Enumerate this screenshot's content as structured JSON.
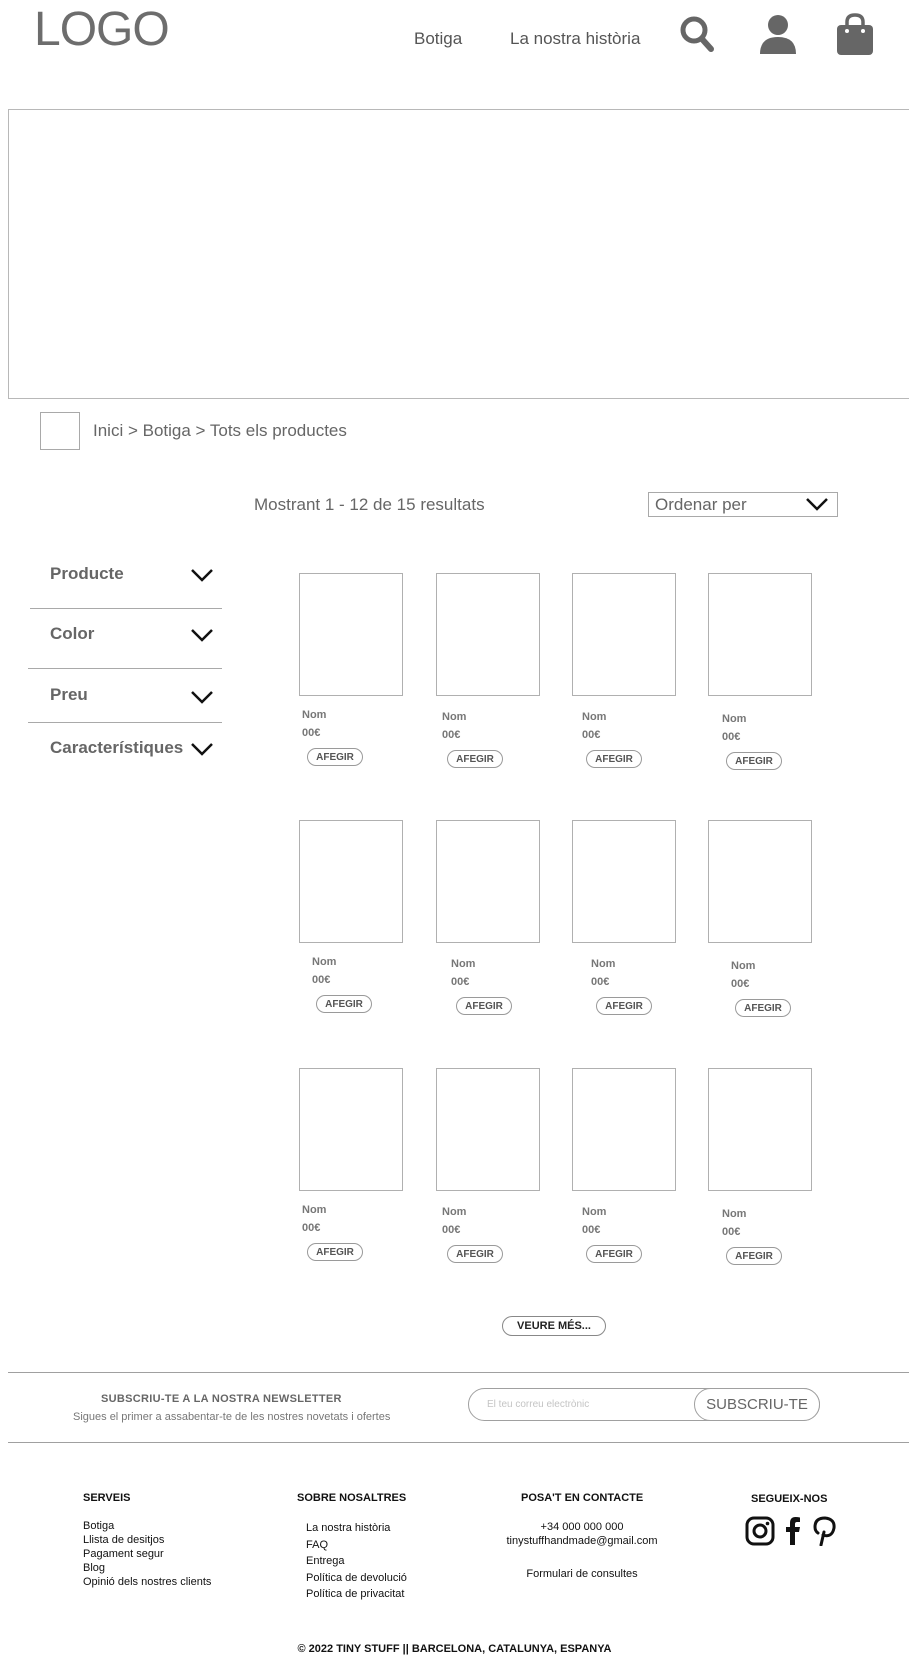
{
  "header": {
    "logo": "LOGO",
    "nav": [
      "Botiga",
      "La nostra història"
    ],
    "icons": [
      "search-icon",
      "user-icon",
      "shopping-bag-icon"
    ]
  },
  "breadcrumb": "Inici > Botiga > Tots els productes",
  "results_text": "Mostrant 1 - 12 de 15 resultats",
  "sort": {
    "label": "Ordenar per"
  },
  "filters": [
    "Producte",
    "Color",
    "Preu",
    "Característiques"
  ],
  "products": [
    {
      "name": "Nom",
      "price": "00€",
      "button": "AFEGIR"
    },
    {
      "name": "Nom",
      "price": "00€",
      "button": "AFEGIR"
    },
    {
      "name": "Nom",
      "price": "00€",
      "button": "AFEGIR"
    },
    {
      "name": "Nom",
      "price": "00€",
      "button": "AFEGIR"
    },
    {
      "name": "Nom",
      "price": "00€",
      "button": "AFEGIR"
    },
    {
      "name": "Nom",
      "price": "00€",
      "button": "AFEGIR"
    },
    {
      "name": "Nom",
      "price": "00€",
      "button": "AFEGIR"
    },
    {
      "name": "Nom",
      "price": "00€",
      "button": "AFEGIR"
    },
    {
      "name": "Nom",
      "price": "00€",
      "button": "AFEGIR"
    },
    {
      "name": "Nom",
      "price": "00€",
      "button": "AFEGIR"
    },
    {
      "name": "Nom",
      "price": "00€",
      "button": "AFEGIR"
    },
    {
      "name": "Nom",
      "price": "00€",
      "button": "AFEGIR"
    }
  ],
  "more_button": "VEURE MÉS...",
  "newsletter": {
    "title": "SUBSCRIU-TE A LA NOSTRA NEWSLETTER",
    "subtitle": "Sigues el primer a assabentar-te de les nostres novetats i ofertes",
    "placeholder": "El teu correu electrònic",
    "button": "SUBSCRIU-TE"
  },
  "footer": {
    "serveis": {
      "title": "SERVEIS",
      "items": [
        "Botiga",
        "Llista de desitjos",
        "Pagament segur",
        "Blog",
        "Opinió dels nostres clients"
      ]
    },
    "sobre": {
      "title": "SOBRE NOSALTRES",
      "items": [
        "La nostra història",
        "FAQ",
        "Entrega",
        "Política de devolució",
        "Política de privacitat"
      ]
    },
    "contacte": {
      "title": "POSA'T EN CONTACTE",
      "phone": "+34 000 000 000",
      "email": "tinystuffhandmade@gmail.com",
      "form": "Formulari de consultes"
    },
    "social": {
      "title": "SEGUEIX-NOS",
      "icons": [
        "instagram-icon",
        "facebook-icon",
        "pinterest-icon"
      ]
    },
    "copyright": "© 2022 TINY STUFF || BARCELONA, CATALUNYA, ESPANYA"
  }
}
